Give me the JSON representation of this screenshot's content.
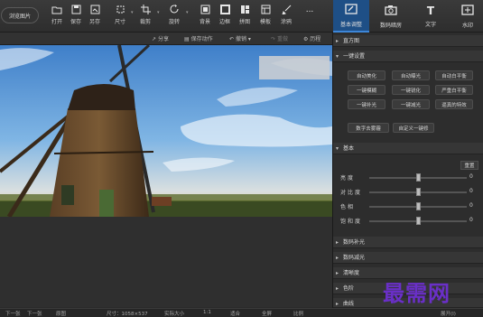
{
  "toolbar": {
    "browse": "浏览图片",
    "tools": [
      {
        "label": "打开",
        "icon": "folder-icon"
      },
      {
        "label": "保存",
        "icon": "save-icon"
      },
      {
        "label": "另存",
        "icon": "save-as-icon"
      },
      {
        "label": "尺寸",
        "icon": "resize-icon"
      },
      {
        "label": "裁剪",
        "icon": "crop-icon"
      },
      {
        "label": "旋转",
        "icon": "rotate-icon"
      },
      {
        "label": "背景",
        "icon": "background-icon"
      },
      {
        "label": "边框",
        "icon": "border-icon"
      },
      {
        "label": "拼图",
        "icon": "collage-icon"
      },
      {
        "label": "模板",
        "icon": "template-icon"
      },
      {
        "label": "涂鸦",
        "icon": "brush-icon"
      },
      {
        "label": "...",
        "icon": "more-icon"
      }
    ]
  },
  "right_tabs": [
    {
      "label": "基本调整",
      "icon": "adjust-icon",
      "active": true
    },
    {
      "label": "数码暗房",
      "icon": "camera-icon",
      "active": false
    },
    {
      "label": "文字",
      "icon": "text-icon",
      "active": false
    },
    {
      "label": "水印",
      "icon": "watermark-icon",
      "active": false
    }
  ],
  "subbar": {
    "share": "分享",
    "save_action": "保存动作",
    "undo": "撤销",
    "redo": "重做",
    "history": "历程"
  },
  "panel": {
    "histogram": "直方图",
    "one_click": "一键设置",
    "one_click_buttons": [
      [
        "自动美化",
        "自动曝光",
        "自动白平衡"
      ],
      [
        "一键模糊",
        "一键锐化",
        "严重白平衡"
      ],
      [
        "一键补光",
        "一键减光",
        "逼真的特效"
      ]
    ],
    "extra_buttons": [
      "数字去雾霾",
      "自定义一键修"
    ],
    "basic": "基本",
    "reset": "重置",
    "sliders": [
      {
        "label": "亮度",
        "value": 0,
        "position": 0.5
      },
      {
        "label": "对比度",
        "value": 0,
        "position": 0.5
      },
      {
        "label": "色相",
        "value": 0,
        "position": 0.5
      },
      {
        "label": "饱和度",
        "value": 0,
        "position": 0.5
      }
    ],
    "collapsed_sections": [
      "数码补光",
      "数码减光",
      "清晰度",
      "色阶",
      "曲线"
    ]
  },
  "status": {
    "items": [
      "下一张",
      "下一张",
      "原图",
      "尺寸：1058×537",
      "实际大小",
      "1:1",
      "适合",
      "全屏",
      "比例",
      "展开(I)"
    ]
  },
  "watermark": "最需网",
  "colors": {
    "accent": "#1e4f86",
    "watermark": "#6a2fc8"
  }
}
